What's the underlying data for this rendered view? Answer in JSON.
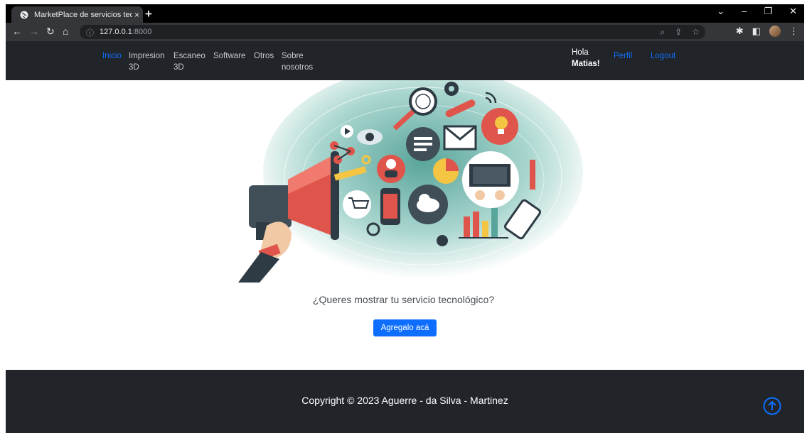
{
  "browser": {
    "tab_title": "MarketPlace de servicios tecnológicos",
    "close_glyph": "×",
    "new_tab_glyph": "+",
    "window_controls": [
      "⌄",
      "–",
      "❐",
      "✕"
    ],
    "url_host": "127.0.0.1",
    "url_port": ":8000"
  },
  "navbar": {
    "links": [
      {
        "label": "Inicio",
        "active": true
      },
      {
        "label": "Impresion 3D"
      },
      {
        "label": "Escaneo 3D"
      },
      {
        "label": "Software"
      },
      {
        "label": "Otros"
      },
      {
        "label": "Sobre nosotros"
      }
    ],
    "greeting": "Hola",
    "user_name": "Matias!",
    "profile_label": "Perfil",
    "logout_label": "Logout"
  },
  "hero": {
    "illustration": "megaphone-marketing-icons",
    "question": "¿Queres mostrar tu servicio tecnológico?",
    "cta_label": "Agregalo acá"
  },
  "footer": {
    "copyright": "Copyright © 2023 Aguerre - da Silva - Martinez"
  },
  "colors": {
    "primary": "#0d6efd",
    "dark": "#212529",
    "teal": "#5aa59b",
    "red": "#e0554b"
  }
}
